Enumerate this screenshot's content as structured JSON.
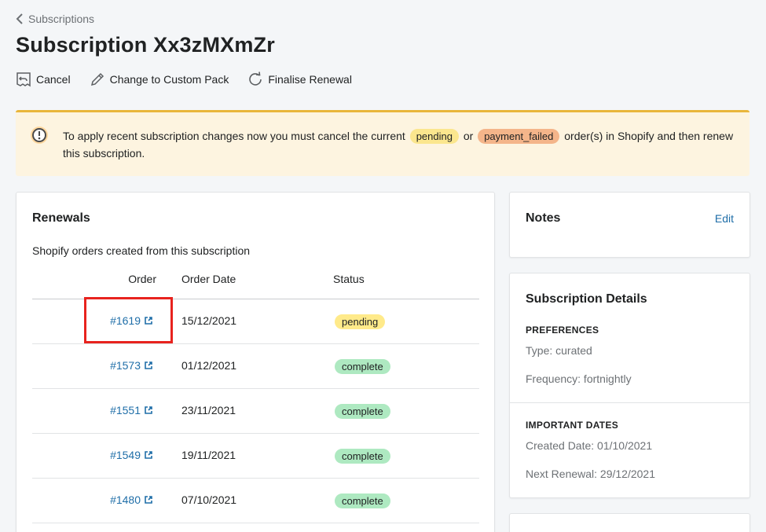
{
  "breadcrumb": {
    "label": "Subscriptions"
  },
  "page": {
    "title": "Subscription Xx3zMXmZr"
  },
  "actions": [
    {
      "label": "Cancel",
      "icon": "receipt-cancel-icon"
    },
    {
      "label": "Change to Custom Pack",
      "icon": "pencil-icon"
    },
    {
      "label": "Finalise Renewal",
      "icon": "refresh-icon"
    }
  ],
  "banner": {
    "icon": "alert-circle-icon",
    "text_before": "To apply recent subscription changes now you must cancel the current",
    "pill_pending": "pending",
    "text_or": "or",
    "pill_failed": "payment_failed",
    "text_after": "order(s) in Shopify and then renew this subscription."
  },
  "renewals": {
    "title": "Renewals",
    "subtitle": "Shopify orders created from this subscription",
    "columns": {
      "order": "Order",
      "date": "Order Date",
      "status": "Status"
    },
    "rows": [
      {
        "order": "#1619",
        "date": "15/12/2021",
        "status": "pending"
      },
      {
        "order": "#1573",
        "date": "01/12/2021",
        "status": "complete"
      },
      {
        "order": "#1551",
        "date": "23/11/2021",
        "status": "complete"
      },
      {
        "order": "#1549",
        "date": "19/11/2021",
        "status": "complete"
      },
      {
        "order": "#1480",
        "date": "07/10/2021",
        "status": "complete"
      }
    ]
  },
  "notes": {
    "title": "Notes",
    "edit_label": "Edit"
  },
  "details": {
    "title": "Subscription Details",
    "preferences_heading": "PREFERENCES",
    "type": "Type: curated",
    "frequency": "Frequency: fortnightly",
    "dates_heading": "IMPORTANT DATES",
    "created": "Created Date: 01/10/2021",
    "next_renewal": "Next Renewal: 29/12/2021"
  },
  "colors": {
    "link": "#1f6ea8",
    "banner_bg": "#fdf4e0",
    "banner_border": "#e9b63b",
    "pending": "#ffea8a",
    "complete": "#aee9c1",
    "payment_failed": "#f4b58a",
    "highlight": "#e8231e"
  }
}
